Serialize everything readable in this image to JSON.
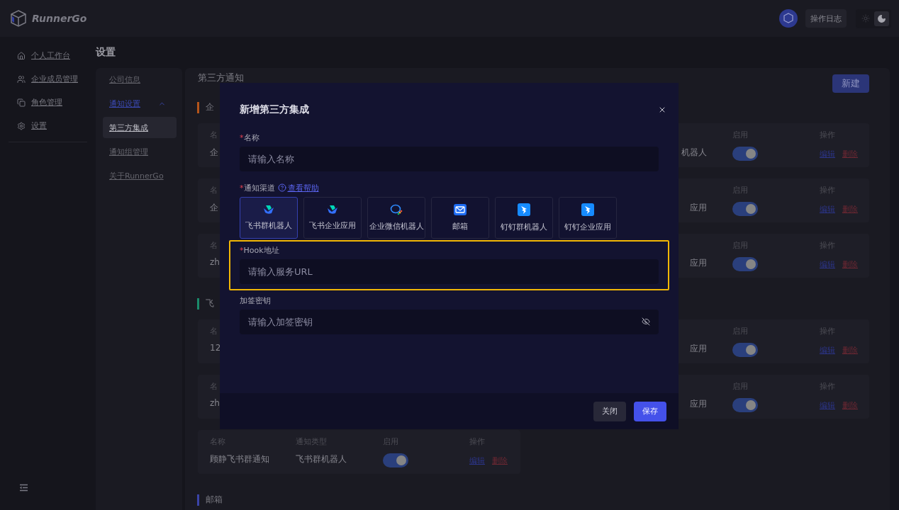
{
  "app": {
    "logo_text": "RunnerGo"
  },
  "header": {
    "log_button": "操作日志",
    "theme": [
      {
        "kind": "light",
        "selected": false
      },
      {
        "kind": "dark",
        "selected": true
      }
    ]
  },
  "sidebar": {
    "items": [
      {
        "kind": "home",
        "label": "个人工作台"
      },
      {
        "kind": "users",
        "label": "企业成员管理"
      },
      {
        "kind": "roles",
        "label": "角色管理"
      },
      {
        "kind": "settings",
        "label": "设置"
      }
    ]
  },
  "page_title": "设置",
  "settings_nav": {
    "items": [
      {
        "label": "公司信息",
        "selected": false
      },
      {
        "label": "通知设置",
        "selected": false,
        "expanded": true,
        "children": [
          {
            "label": "第三方集成",
            "selected": true
          },
          {
            "label": "通知组管理",
            "selected": false
          }
        ]
      },
      {
        "label": "关于RunnerGo",
        "selected": false
      }
    ]
  },
  "content": {
    "title": "第三方通知",
    "new_button": "新建",
    "sections": [
      {
        "title": "企",
        "color": "#b4541a",
        "cards": [
          {
            "kind": "partial",
            "name_label": "名",
            "name": "企",
            "type": "机器人",
            "enabled_label": "启用",
            "enabled": true,
            "actions_label": "操作",
            "actions": [
              "编辑",
              "删除"
            ]
          },
          {
            "kind": "partial",
            "name_label": "名",
            "name": "企",
            "type": "应用",
            "enabled_label": "启用",
            "enabled": true,
            "actions_label": "操作",
            "actions": [
              "编辑",
              "删除"
            ]
          },
          {
            "kind": "partial",
            "name_label": "名",
            "name": "zh",
            "type": "应用",
            "enabled_label": "启用",
            "enabled": true,
            "actions_label": "操作",
            "actions": [
              "编辑",
              "删除"
            ]
          }
        ]
      },
      {
        "title": "飞",
        "color": "#1a8a6a",
        "cards": [
          {
            "kind": "partial",
            "name_label": "名",
            "name": "12",
            "type": "应用",
            "enabled_label": "启用",
            "enabled": true,
            "actions_label": "操作",
            "actions": [
              "编辑",
              "删除"
            ]
          },
          {
            "kind": "partial",
            "name_label": "名",
            "name": "zh",
            "type": "应用",
            "enabled_label": "启用",
            "enabled": true,
            "actions_label": "操作",
            "actions": [
              "编辑",
              "删除"
            ]
          },
          {
            "kind": "full",
            "name_label": "名称",
            "name": "顾静飞书群通知",
            "type_label": "通知类型",
            "type": "飞书群机器人",
            "enabled_label": "启用",
            "enabled": true,
            "actions_label": "操作",
            "actions": [
              "编辑",
              "删除"
            ]
          }
        ]
      },
      {
        "title": "邮箱",
        "color": "#3a44a8"
      }
    ]
  },
  "modal": {
    "title": "新增第三方集成",
    "fields": [
      {
        "kind": "text",
        "mark": "*",
        "label": "名称",
        "placeholder": "请输入名称",
        "highlighted": false
      },
      {
        "kind": "channels",
        "mark": "*",
        "label": "通知渠道",
        "help": "查看帮助",
        "channels": [
          {
            "kind": "feishu",
            "label": "飞书群机器人",
            "selected": true
          },
          {
            "kind": "feishu",
            "label": "飞书企业应用",
            "selected": false
          },
          {
            "kind": "wecom",
            "label": "企业微信机器人",
            "selected": false
          },
          {
            "kind": "mail",
            "label": "邮箱",
            "selected": false
          },
          {
            "kind": "dingtalk",
            "label": "钉钉群机器人",
            "selected": false
          },
          {
            "kind": "dingtalk",
            "label": "钉钉企业应用",
            "selected": false
          }
        ]
      },
      {
        "kind": "text",
        "mark": "*",
        "label": "Hook地址",
        "placeholder": "请输入服务URL",
        "highlighted": true
      },
      {
        "kind": "secret",
        "label": "加签密钥",
        "placeholder": "请输入加签密钥",
        "highlighted": false
      }
    ],
    "buttons": [
      {
        "kind": "secondary",
        "label": "关闭"
      },
      {
        "kind": "primary",
        "label": "保存"
      }
    ]
  }
}
